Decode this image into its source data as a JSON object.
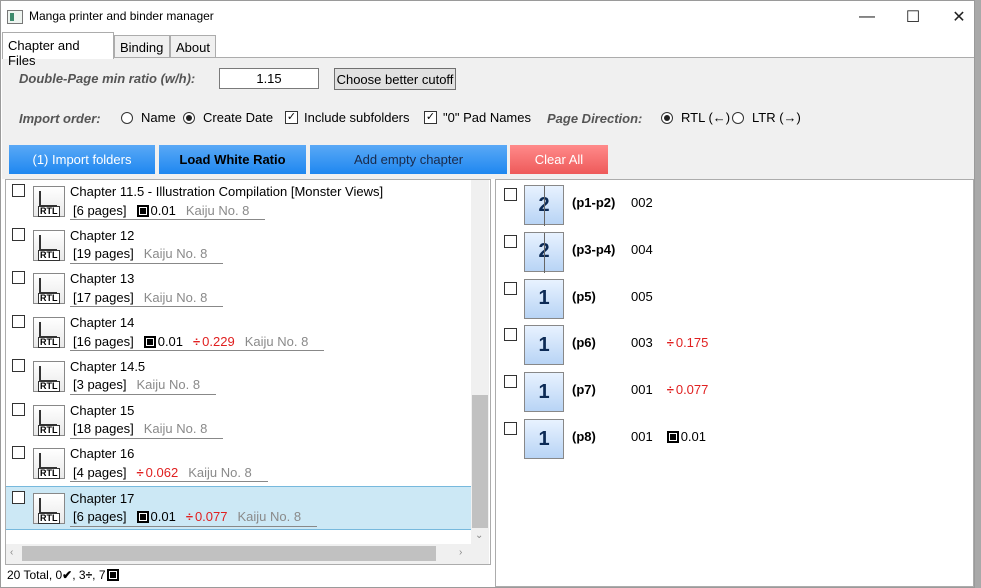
{
  "window": {
    "title": "Manga printer and binder manager",
    "minimize": "—",
    "maximize": "☐",
    "close": "✕"
  },
  "tabs": [
    {
      "label": "Chapter and Files"
    },
    {
      "label": "Binding"
    },
    {
      "label": "About"
    }
  ],
  "settings": {
    "ratio_label": "Double-Page min ratio (w/h):",
    "ratio_value": "1.15",
    "cutoff_button": "Choose better cutoff",
    "import_order_label": "Import order:",
    "opt_name": "Name",
    "opt_create_date": "Create Date",
    "include_subfolders": "Include subfolders",
    "pad_names": "\"0\" Pad Names",
    "page_direction_label": "Page Direction:",
    "rtl": "RTL (←)",
    "ltr": "LTR (→)"
  },
  "actions": {
    "import": "(1) Import folders",
    "load_white": "Load White Ratio",
    "add_empty": "Add empty chapter",
    "clear_all": "Clear All"
  },
  "colors": {
    "accent": "#1e87f0",
    "danger": "#ee5a5a",
    "warning_red": "#e02020",
    "selected_row": "#cce8f5"
  },
  "chapters": [
    {
      "title": "Chapter 11.5 - Illustration Compilation [Monster Views]",
      "pages": "[6 pages]",
      "white": "0.01",
      "split": "",
      "series": "Kaiju No. 8"
    },
    {
      "title": "Chapter 12",
      "pages": "[19 pages]",
      "white": "",
      "split": "",
      "series": "Kaiju No. 8"
    },
    {
      "title": "Chapter 13",
      "pages": "[17 pages]",
      "white": "",
      "split": "",
      "series": "Kaiju No. 8"
    },
    {
      "title": "Chapter 14",
      "pages": "[16 pages]",
      "white": "0.01",
      "split": "0.229",
      "series": "Kaiju No. 8"
    },
    {
      "title": "Chapter 14.5",
      "pages": "[3 pages]",
      "white": "",
      "split": "",
      "series": "Kaiju No. 8"
    },
    {
      "title": "Chapter 15",
      "pages": "[18 pages]",
      "white": "",
      "split": "",
      "series": "Kaiju No. 8"
    },
    {
      "title": "Chapter 16",
      "pages": "[4 pages]",
      "white": "",
      "split": "0.062",
      "series": "Kaiju No. 8"
    },
    {
      "title": "Chapter 17",
      "pages": "[6 pages]",
      "white": "0.01",
      "split": "0.077",
      "series": "Kaiju No. 8"
    }
  ],
  "rtl_icon_text": "RTL",
  "page_list": [
    {
      "count": "2",
      "range": "(p1-p2)",
      "file": "002",
      "split": "",
      "white": ""
    },
    {
      "count": "2",
      "range": "(p3-p4)",
      "file": "004",
      "split": "",
      "white": ""
    },
    {
      "count": "1",
      "range": "(p5)",
      "file": "005",
      "split": "",
      "white": ""
    },
    {
      "count": "1",
      "range": "(p6)",
      "file": "003",
      "split": "0.175",
      "white": ""
    },
    {
      "count": "1",
      "range": "(p7)",
      "file": "001",
      "split": "0.077",
      "white": ""
    },
    {
      "count": "1",
      "range": "(p8)",
      "file": "001",
      "split": "",
      "white": "0.01"
    }
  ],
  "status": {
    "total": "20 Total, 0",
    "split": ", 3",
    "white": ", 7"
  },
  "scroll": {
    "left": "‹",
    "right": "›",
    "down": "⌄"
  }
}
